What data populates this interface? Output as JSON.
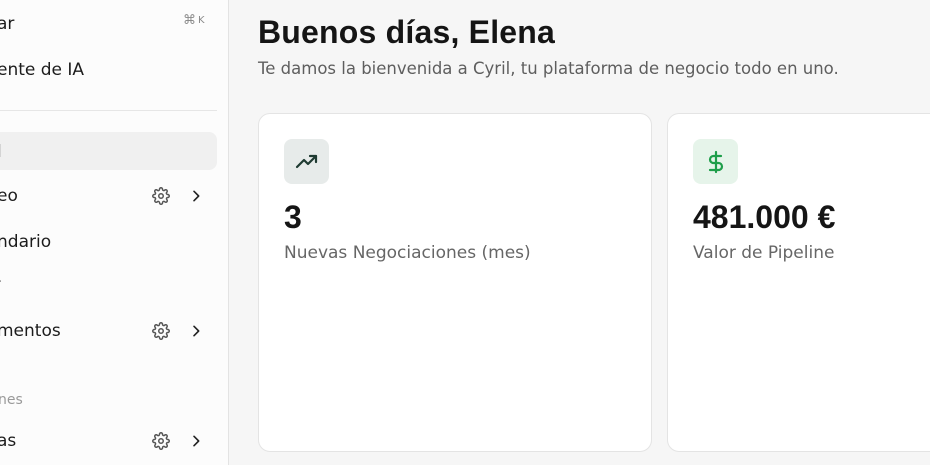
{
  "sidebar": {
    "search": {
      "label": "ar",
      "shortcut_symbol": "⌘",
      "shortcut_key": "K"
    },
    "items": [
      {
        "label": "ente de IA"
      },
      {
        "label": "l"
      },
      {
        "label": "eo"
      },
      {
        "label": "ndario"
      },
      {
        "label": "mentos"
      },
      {
        "label": "as"
      }
    ],
    "sections": [
      {
        "label": "·"
      },
      {
        "label": "nes"
      }
    ]
  },
  "main": {
    "greeting": "Buenos días, Elena",
    "subtitle": "Te damos la bienvenida a Cyril, tu plataforma de negocio todo en uno.",
    "cards": [
      {
        "icon": "trending-up-icon",
        "value": "3",
        "label": "Nuevas Negociaciones (mes)",
        "accent": "#1f3b32"
      },
      {
        "icon": "dollar-icon",
        "value": "481.000 €",
        "label": "Valor de Pipeline",
        "accent": "#1e9e4a"
      }
    ]
  }
}
